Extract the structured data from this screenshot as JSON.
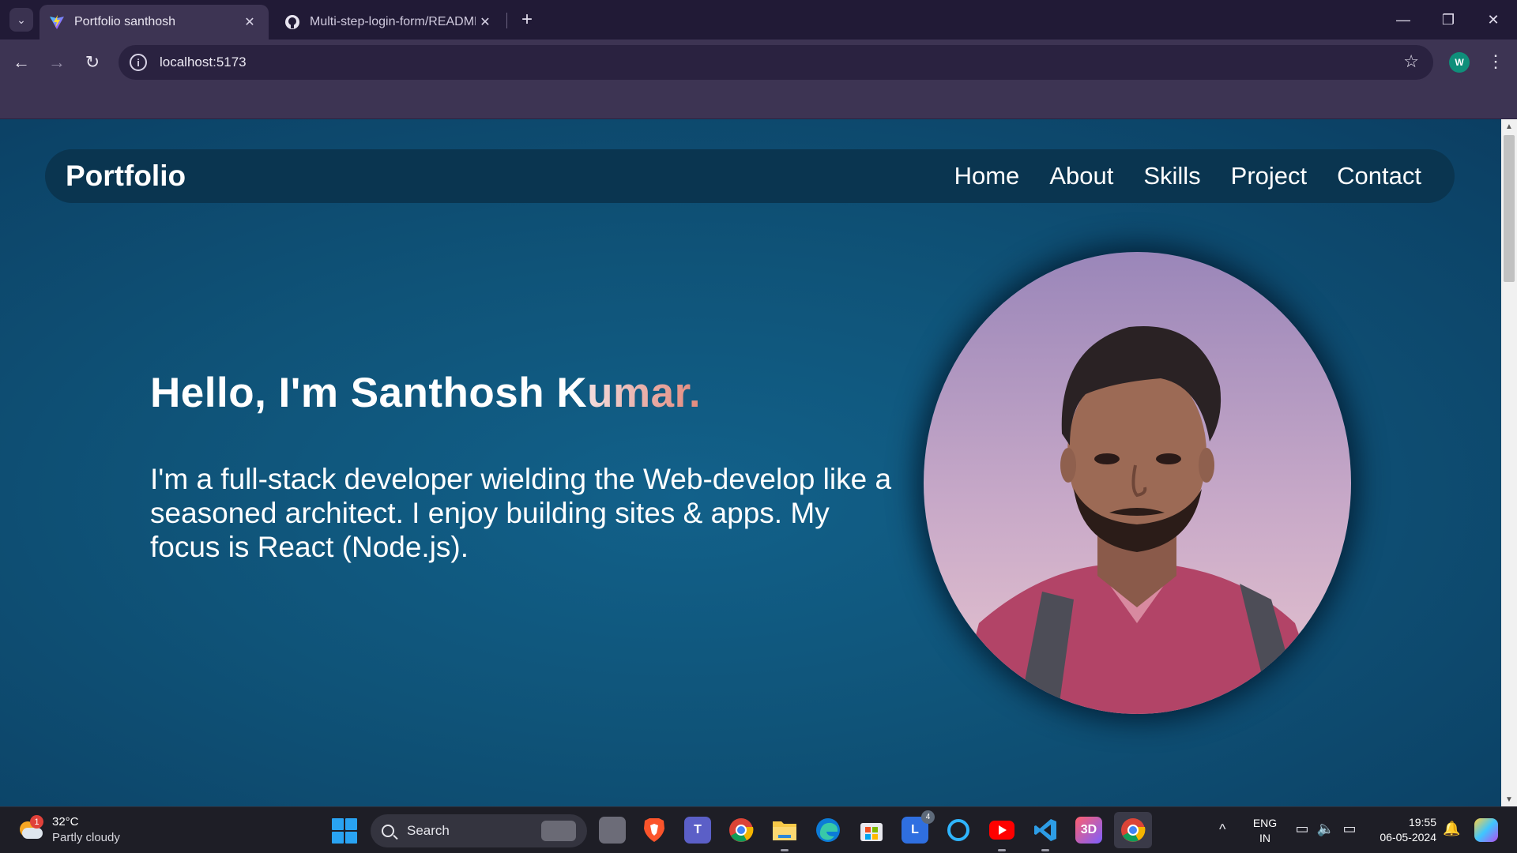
{
  "browser": {
    "tabs": [
      {
        "title": "Portfolio santhosh",
        "active": true,
        "favicon": "vite-icon"
      },
      {
        "title": "Multi-step-login-form/README",
        "active": false,
        "favicon": "github-icon"
      }
    ],
    "new_tab_glyph": "+",
    "close_glyph": "✕",
    "url": "localhost:5173",
    "profile_initial": "W",
    "back_glyph": "←",
    "forward_glyph": "→",
    "reload_glyph": "↻",
    "star_glyph": "☆",
    "menu_glyph": "⋮",
    "info_glyph": "i",
    "window_controls": {
      "minimize": "—",
      "restore": "❐",
      "close": "✕"
    }
  },
  "site": {
    "brand": "Portfolio",
    "nav": [
      "Home",
      "About",
      "Skills",
      "Project",
      "Contact"
    ],
    "hero": {
      "greeting": "Hello, I'm Santhosh K",
      "greeting_accent": "umar.",
      "description": "I'm a full-stack developer wielding the Web-develop like a seasoned architect. I enjoy building sites & apps. My focus is React (Node.js)."
    },
    "colors": {
      "background": "#0f5378",
      "nav_background": "#0a3550",
      "accent_gradient_start": "#f3dede",
      "accent_gradient_end": "#e38a7d"
    }
  },
  "taskbar": {
    "weather": {
      "temperature": "32°C",
      "condition": "Partly cloudy",
      "badge": "1"
    },
    "search_label": "Search",
    "apps": [
      {
        "name": "task-view",
        "label": ""
      },
      {
        "name": "brave",
        "label": ""
      },
      {
        "name": "teams",
        "label": "T"
      },
      {
        "name": "chrome",
        "label": ""
      },
      {
        "name": "file-explorer",
        "label": ""
      },
      {
        "name": "edge",
        "label": ""
      },
      {
        "name": "microsoft-store",
        "label": ""
      },
      {
        "name": "linkedin-learning",
        "label": "L",
        "badge": "4"
      },
      {
        "name": "cortana",
        "label": ""
      },
      {
        "name": "youtube",
        "label": ""
      },
      {
        "name": "vscode",
        "label": ""
      },
      {
        "name": "3d-viewer",
        "label": "3D"
      },
      {
        "name": "chrome-profile",
        "label": ""
      }
    ],
    "language": {
      "line1": "ENG",
      "line2": "IN"
    },
    "time": "19:55",
    "date": "06-05-2024",
    "tray_chevron": "^"
  }
}
